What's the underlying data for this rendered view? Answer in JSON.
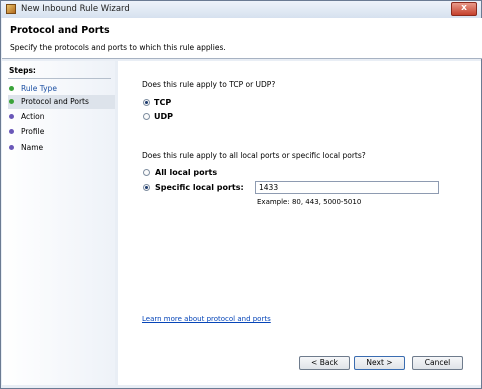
{
  "window": {
    "title": "New Inbound Rule Wizard",
    "close_glyph": "x"
  },
  "header": {
    "title": "Protocol and Ports",
    "subtitle": "Specify the protocols and ports to which this rule applies."
  },
  "steps": {
    "label": "Steps:",
    "items": [
      {
        "label": "Rule Type",
        "dot_color": "#3aa33a",
        "current": false,
        "label_color": "#1b4fa3"
      },
      {
        "label": "Protocol and Ports",
        "dot_color": "#3aa33a",
        "current": true,
        "label_color": "#000000"
      },
      {
        "label": "Action",
        "dot_color": "#6a58b8",
        "current": false,
        "label_color": "#000000"
      },
      {
        "label": "Profile",
        "dot_color": "#6a58b8",
        "current": false,
        "label_color": "#000000"
      },
      {
        "label": "Name",
        "dot_color": "#6a58b8",
        "current": false,
        "label_color": "#000000"
      }
    ]
  },
  "protocol": {
    "question": "Does this rule apply to TCP or UDP?",
    "tcp_label": "TCP",
    "udp_label": "UDP",
    "selected": "TCP"
  },
  "ports": {
    "question": "Does this rule apply to all local ports or specific local ports?",
    "all_label": "All local ports",
    "specific_label": "Specific local ports:",
    "selected": "Specific local ports:",
    "value": "1433",
    "example": "Example: 80, 443, 5000-5010"
  },
  "learn_link": "Learn more about protocol and ports",
  "buttons": {
    "back": "< Back",
    "next": "Next >",
    "cancel": "Cancel"
  }
}
